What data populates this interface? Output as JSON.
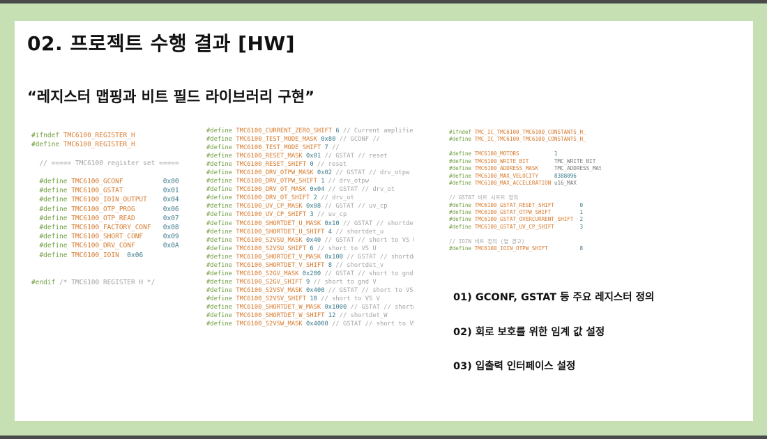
{
  "slide": {
    "title": "02. 프로젝트 수행 결과 [HW]",
    "subtitle": "“레지스터 맵핑과 비트 필드 라이브러리 구현”"
  },
  "code_blocks": [
    {
      "lines": [
        [
          [
            "kw",
            "#ifndef "
          ],
          [
            "mc",
            "TMC6100_REGISTER_H"
          ]
        ],
        [
          [
            "kw",
            "#define "
          ],
          [
            "mc",
            "TMC6100_REGISTER_H"
          ]
        ],
        [],
        [
          [
            "cm",
            "  // ===== TMC6100 register set ====="
          ]
        ],
        [],
        [
          [
            "kw",
            "  #define "
          ],
          [
            "mc",
            "TMC6100_GCONF          "
          ],
          [
            "num",
            "0x00"
          ]
        ],
        [
          [
            "kw",
            "  #define "
          ],
          [
            "mc",
            "TMC6100_GSTAT          "
          ],
          [
            "num",
            "0x01"
          ]
        ],
        [
          [
            "kw",
            "  #define "
          ],
          [
            "mc",
            "TMC6100_IOIN_OUTPUT    "
          ],
          [
            "num",
            "0x04"
          ]
        ],
        [
          [
            "kw",
            "  #define "
          ],
          [
            "mc",
            "TMC6100_OTP_PROG       "
          ],
          [
            "num",
            "0x06"
          ]
        ],
        [
          [
            "kw",
            "  #define "
          ],
          [
            "mc",
            "TMC6100_OTP_READ       "
          ],
          [
            "num",
            "0x07"
          ]
        ],
        [
          [
            "kw",
            "  #define "
          ],
          [
            "mc",
            "TMC6100_FACTORY_CONF   "
          ],
          [
            "num",
            "0x08"
          ]
        ],
        [
          [
            "kw",
            "  #define "
          ],
          [
            "mc",
            "TMC6100_SHORT_CONF     "
          ],
          [
            "num",
            "0x09"
          ]
        ],
        [
          [
            "kw",
            "  #define "
          ],
          [
            "mc",
            "TMC6100_DRV_CONF       "
          ],
          [
            "num",
            "0x0A"
          ]
        ],
        [
          [
            "kw",
            "  #define "
          ],
          [
            "mc",
            "TMC6100_IOIN  "
          ],
          [
            "num",
            "0x06"
          ]
        ],
        [],
        [],
        [
          [
            "kw",
            "#endif "
          ],
          [
            "cm",
            "/* TMC6100 REGISTER H */"
          ]
        ]
      ]
    },
    {
      "lines": [
        [
          [
            "kw",
            "#define "
          ],
          [
            "mc",
            "TMC6100_CURRENT_ZERO_SHIFT "
          ],
          [
            "num",
            "6"
          ],
          [
            "cm",
            " // Current amplifier off"
          ]
        ],
        [
          [
            "kw",
            "#define "
          ],
          [
            "mc",
            "TMC6100_TEST_MODE_MASK "
          ],
          [
            "num",
            "0x80"
          ],
          [
            "cm",
            " // GCONF //"
          ]
        ],
        [
          [
            "kw",
            "#define "
          ],
          [
            "mc",
            "TMC6100_TEST_MODE_SHIFT "
          ],
          [
            "num",
            "7"
          ],
          [
            "cm",
            " //"
          ]
        ],
        [
          [
            "kw",
            "#define "
          ],
          [
            "mc",
            "TMC6100_RESET_MASK "
          ],
          [
            "num",
            "0x01"
          ],
          [
            "cm",
            " // GSTAT // reset"
          ]
        ],
        [
          [
            "kw",
            "#define "
          ],
          [
            "mc",
            "TMC6100_RESET_SHIFT "
          ],
          [
            "num",
            "0"
          ],
          [
            "cm",
            " // reset"
          ]
        ],
        [
          [
            "kw",
            "#define "
          ],
          [
            "mc",
            "TMC6100_DRV_OTPW_MASK "
          ],
          [
            "num",
            "0x02"
          ],
          [
            "cm",
            " // GSTAT // drv_otpw"
          ]
        ],
        [
          [
            "kw",
            "#define "
          ],
          [
            "mc",
            "TMC6100_DRV_OTPW_SHIFT "
          ],
          [
            "num",
            "1"
          ],
          [
            "cm",
            " // drv_otpw"
          ]
        ],
        [
          [
            "kw",
            "#define "
          ],
          [
            "mc",
            "TMC6100_DRV_OT_MASK "
          ],
          [
            "num",
            "0x04"
          ],
          [
            "cm",
            " // GSTAT // drv_ot"
          ]
        ],
        [
          [
            "kw",
            "#define "
          ],
          [
            "mc",
            "TMC6100_DRV_OT_SHIFT "
          ],
          [
            "num",
            "2"
          ],
          [
            "cm",
            " // drv_ot"
          ]
        ],
        [
          [
            "kw",
            "#define "
          ],
          [
            "mc",
            "TMC6100_UV_CP_MASK "
          ],
          [
            "num",
            "0x08"
          ],
          [
            "cm",
            " // GSTAT // uv_cp"
          ]
        ],
        [
          [
            "kw",
            "#define "
          ],
          [
            "mc",
            "TMC6100_UV_CP_SHIFT "
          ],
          [
            "num",
            "3"
          ],
          [
            "cm",
            " // uv_cp"
          ]
        ],
        [
          [
            "kw",
            "#define "
          ],
          [
            "mc",
            "TMC6100_SHORTDET_U_MASK "
          ],
          [
            "num",
            "0x10"
          ],
          [
            "cm",
            " // GSTAT // shortdet_u"
          ]
        ],
        [
          [
            "kw",
            "#define "
          ],
          [
            "mc",
            "TMC6100_SHORTDET_U_SHIFT "
          ],
          [
            "num",
            "4"
          ],
          [
            "cm",
            " // shortdet_u"
          ]
        ],
        [
          [
            "kw",
            "#define "
          ],
          [
            "mc",
            "TMC6100_S2VSU_MASK "
          ],
          [
            "num",
            "0x40"
          ],
          [
            "cm",
            " // GSTAT // short to VS U"
          ]
        ],
        [
          [
            "kw",
            "#define "
          ],
          [
            "mc",
            "TMC6100_S2VSU_SHIFT "
          ],
          [
            "num",
            "6"
          ],
          [
            "cm",
            " // short to VS U"
          ]
        ],
        [
          [
            "kw",
            "#define "
          ],
          [
            "mc",
            "TMC6100_SHORTDET_V_MASK "
          ],
          [
            "num",
            "0x100"
          ],
          [
            "cm",
            " // GSTAT // shortdet_v"
          ]
        ],
        [
          [
            "kw",
            "#define "
          ],
          [
            "mc",
            "TMC6100_SHORTDET_V_SHIFT "
          ],
          [
            "num",
            "8"
          ],
          [
            "cm",
            " // shortdet_v"
          ]
        ],
        [
          [
            "kw",
            "#define "
          ],
          [
            "mc",
            "TMC6100_S2GV_MASK "
          ],
          [
            "num",
            "0x200"
          ],
          [
            "cm",
            " // GSTAT // short to gnd V"
          ]
        ],
        [
          [
            "kw",
            "#define "
          ],
          [
            "mc",
            "TMC6100_S2GV_SHIFT "
          ],
          [
            "num",
            "9"
          ],
          [
            "cm",
            " // short to gnd V"
          ]
        ],
        [
          [
            "kw",
            "#define "
          ],
          [
            "mc",
            "TMC6100_S2VSV_MASK "
          ],
          [
            "num",
            "0x400"
          ],
          [
            "cm",
            " // GSTAT // short to VS V"
          ]
        ],
        [
          [
            "kw",
            "#define "
          ],
          [
            "mc",
            "TMC6100_S2VSV_SHIFT "
          ],
          [
            "num",
            "10"
          ],
          [
            "cm",
            " // short to VS V"
          ]
        ],
        [
          [
            "kw",
            "#define "
          ],
          [
            "mc",
            "TMC6100_SHORTDET_W_MASK "
          ],
          [
            "num",
            "0x1000"
          ],
          [
            "cm",
            " // GSTAT // shortdet_w"
          ]
        ],
        [
          [
            "kw",
            "#define "
          ],
          [
            "mc",
            "TMC6100_SHORTDET_W_SHIFT "
          ],
          [
            "num",
            "12"
          ],
          [
            "cm",
            " // shortdet_W"
          ]
        ],
        [
          [
            "kw",
            "#define "
          ],
          [
            "mc",
            "TMC6100_S2VSW_MASK "
          ],
          [
            "num",
            "0x4000"
          ],
          [
            "cm",
            " // GSTAT // short to VS W"
          ]
        ]
      ]
    },
    {
      "lines": [
        [
          [
            "kw",
            "#ifndef "
          ],
          [
            "mc",
            "TMC_IC_TMC6100_TMC6100_CONSTANTS_H_"
          ]
        ],
        [
          [
            "kw",
            "#define "
          ],
          [
            "mc",
            "TMC_IC_TMC6100_TMC6100_CONSTANTS_H_"
          ]
        ],
        [],
        [
          [
            "kw",
            "#define "
          ],
          [
            "mc",
            "TMC6100_MOTORS           "
          ],
          [
            "num",
            "1"
          ]
        ],
        [
          [
            "kw",
            "#define "
          ],
          [
            "mc",
            "TMC6100_WRITE_BIT        "
          ],
          [
            "plain",
            "TMC_WRITE_BIT"
          ]
        ],
        [
          [
            "kw",
            "#define "
          ],
          [
            "mc",
            "TMC6100_ADDRESS_MASK     "
          ],
          [
            "plain",
            "TMC_ADDRESS_MASK"
          ]
        ],
        [
          [
            "kw",
            "#define "
          ],
          [
            "mc",
            "TMC6100_MAX_VELOCITY     "
          ],
          [
            "num",
            "8388096"
          ]
        ],
        [
          [
            "kw",
            "#define "
          ],
          [
            "mc",
            "TMC6100_MAX_ACCELERATION "
          ],
          [
            "plain",
            "u16_MAX"
          ]
        ],
        [],
        [
          [
            "cm",
            "// GSTAT 비트 시프트 정의"
          ]
        ],
        [
          [
            "kw",
            "#define "
          ],
          [
            "mc",
            "TMC6100_GSTAT_RESET_SHIFT        "
          ],
          [
            "num",
            "0"
          ]
        ],
        [
          [
            "kw",
            "#define "
          ],
          [
            "mc",
            "TMC6100_GSTAT_OTPW_SHIFT         "
          ],
          [
            "num",
            "1"
          ]
        ],
        [
          [
            "kw",
            "#define "
          ],
          [
            "mc",
            "TMC6100_GSTAT_OVERCURRENT_SHIFT  "
          ],
          [
            "num",
            "2"
          ]
        ],
        [
          [
            "kw",
            "#define "
          ],
          [
            "mc",
            "TMC6100_GSTAT_UV_CP_SHIFT        "
          ],
          [
            "num",
            "3"
          ]
        ],
        [],
        [
          [
            "cm",
            "// IOIN 비트 정의 (열 경고)"
          ]
        ],
        [
          [
            "kw",
            "#define "
          ],
          [
            "mc",
            "TMC6100_IOIN_OTPW_SHIFT          "
          ],
          [
            "num",
            "8"
          ]
        ]
      ]
    }
  ],
  "bullets": [
    "01) GCONF, GSTAT 등 주요 레지스터 정의",
    "02) 회로 보호를 위한 임계 값 설정",
    "03) 입출력 인터페이스 설정"
  ]
}
